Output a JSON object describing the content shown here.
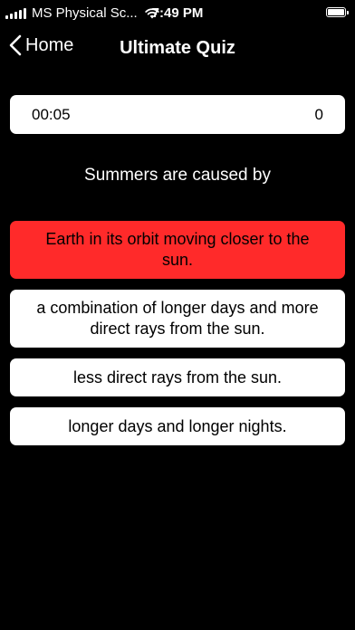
{
  "status_bar": {
    "carrier": "MS Physical Sc...",
    "time": "7:49 PM",
    "icons": [
      "signal-icon",
      "wifi-icon",
      "battery-icon"
    ]
  },
  "nav": {
    "back_label": "Home",
    "title": "Ultimate Quiz"
  },
  "score_card": {
    "timer": "00:05",
    "score": "0"
  },
  "question": {
    "text": "Summers are caused by"
  },
  "answers": [
    {
      "text": "Earth in its orbit moving closer to the sun.",
      "state": "wrong"
    },
    {
      "text": "a combination of longer days and more direct rays from the sun.",
      "state": "default"
    },
    {
      "text": "less direct rays from the sun.",
      "state": "default"
    },
    {
      "text": "longer days and longer nights.",
      "state": "default"
    }
  ],
  "colors": {
    "background": "#000000",
    "card": "#ffffff",
    "wrong_answer": "#ff2a2a",
    "text_light": "#ffffff",
    "text_dark": "#000000"
  }
}
